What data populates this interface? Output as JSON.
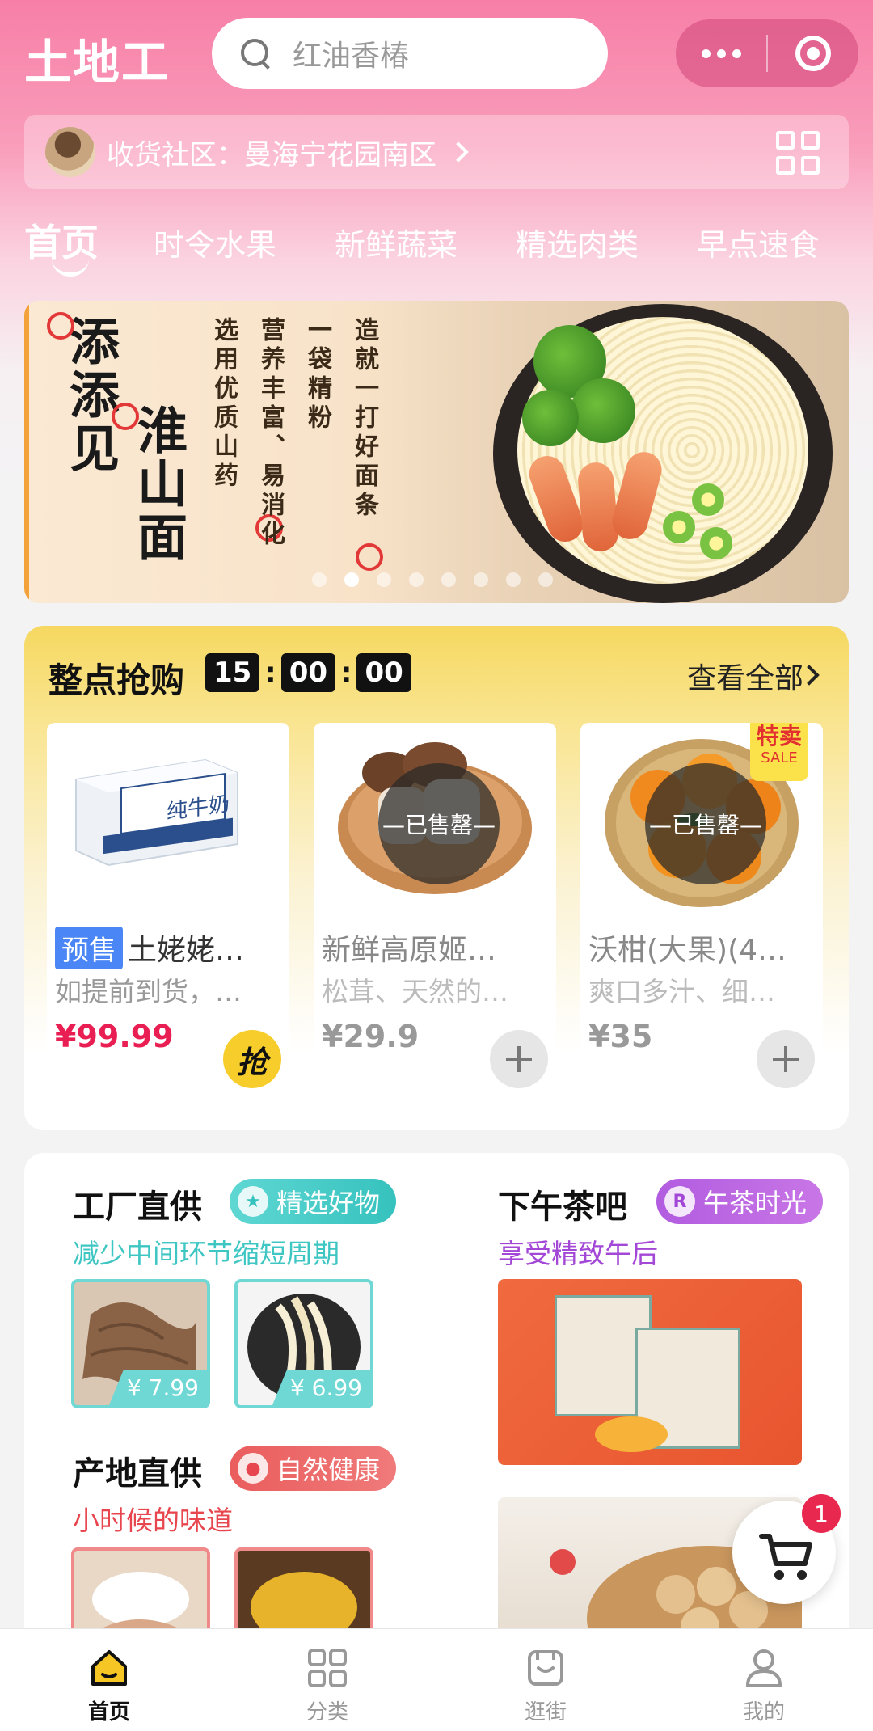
{
  "header": {
    "brand": "土地工",
    "search_placeholder": "红油香椿"
  },
  "community": {
    "label": "收货社区：",
    "value": "曼海宁花园南区"
  },
  "tabs": [
    {
      "label": "首页",
      "active": true
    },
    {
      "label": "时令水果"
    },
    {
      "label": "新鲜蔬菜"
    },
    {
      "label": "精选肉类"
    },
    {
      "label": "早点速食"
    }
  ],
  "banner": {
    "title_line1": "添添见",
    "title_line2": "淮山面",
    "slogan": [
      "造就一打好面条",
      "一袋精粉",
      "营养丰富、易消化",
      "选用优质山药"
    ],
    "slide_count": 8,
    "active_slide": 2
  },
  "flash_sale": {
    "title": "整点抢购",
    "timer": {
      "h": "15",
      "m": "00",
      "s": "00"
    },
    "view_all": "查看全部",
    "products": [
      {
        "tag": "预售",
        "title": "土姥姥…",
        "desc": "如提前到货，…",
        "price": "¥99.99",
        "action": "抢",
        "sold_out": false
      },
      {
        "title": "新鲜高原姬…",
        "desc": "松茸、天然的…",
        "price": "¥29.9",
        "sold_out": true,
        "sold_out_text": "—已售罄—"
      },
      {
        "title": "沃柑(大果)(4…",
        "desc": "爽口多汁、细…",
        "price": "¥35",
        "sold_out": true,
        "sold_out_text": "—已售罄—",
        "badge": "特卖",
        "badge_sub": "SALE"
      }
    ]
  },
  "sections": {
    "factory": {
      "title": "工厂直供",
      "tag": "精选好物",
      "subtitle": "减少中间环节缩短周期",
      "prices": [
        "¥ 7.99",
        "¥ 6.99"
      ]
    },
    "tea": {
      "title": "下午茶吧",
      "tag": "午茶时光",
      "tag_icon": "R",
      "subtitle": "享受精致午后"
    },
    "origin": {
      "title": "产地直供",
      "tag": "自然健康",
      "subtitle": "小时候的味道"
    }
  },
  "cart": {
    "count": "1"
  },
  "bottom_nav": [
    {
      "label": "首页",
      "icon": "home-icon",
      "active": true
    },
    {
      "label": "分类",
      "icon": "category-icon"
    },
    {
      "label": "逛街",
      "icon": "shopping-bag-icon"
    },
    {
      "label": "我的",
      "icon": "user-icon"
    }
  ],
  "colors": {
    "primary_pink": "#f77fa7",
    "price_red": "#e91e52",
    "flash_yellow": "#f6d860",
    "teal_accent": "#3ec6c3",
    "purple_accent": "#a347d6",
    "red_accent": "#e8464e"
  }
}
